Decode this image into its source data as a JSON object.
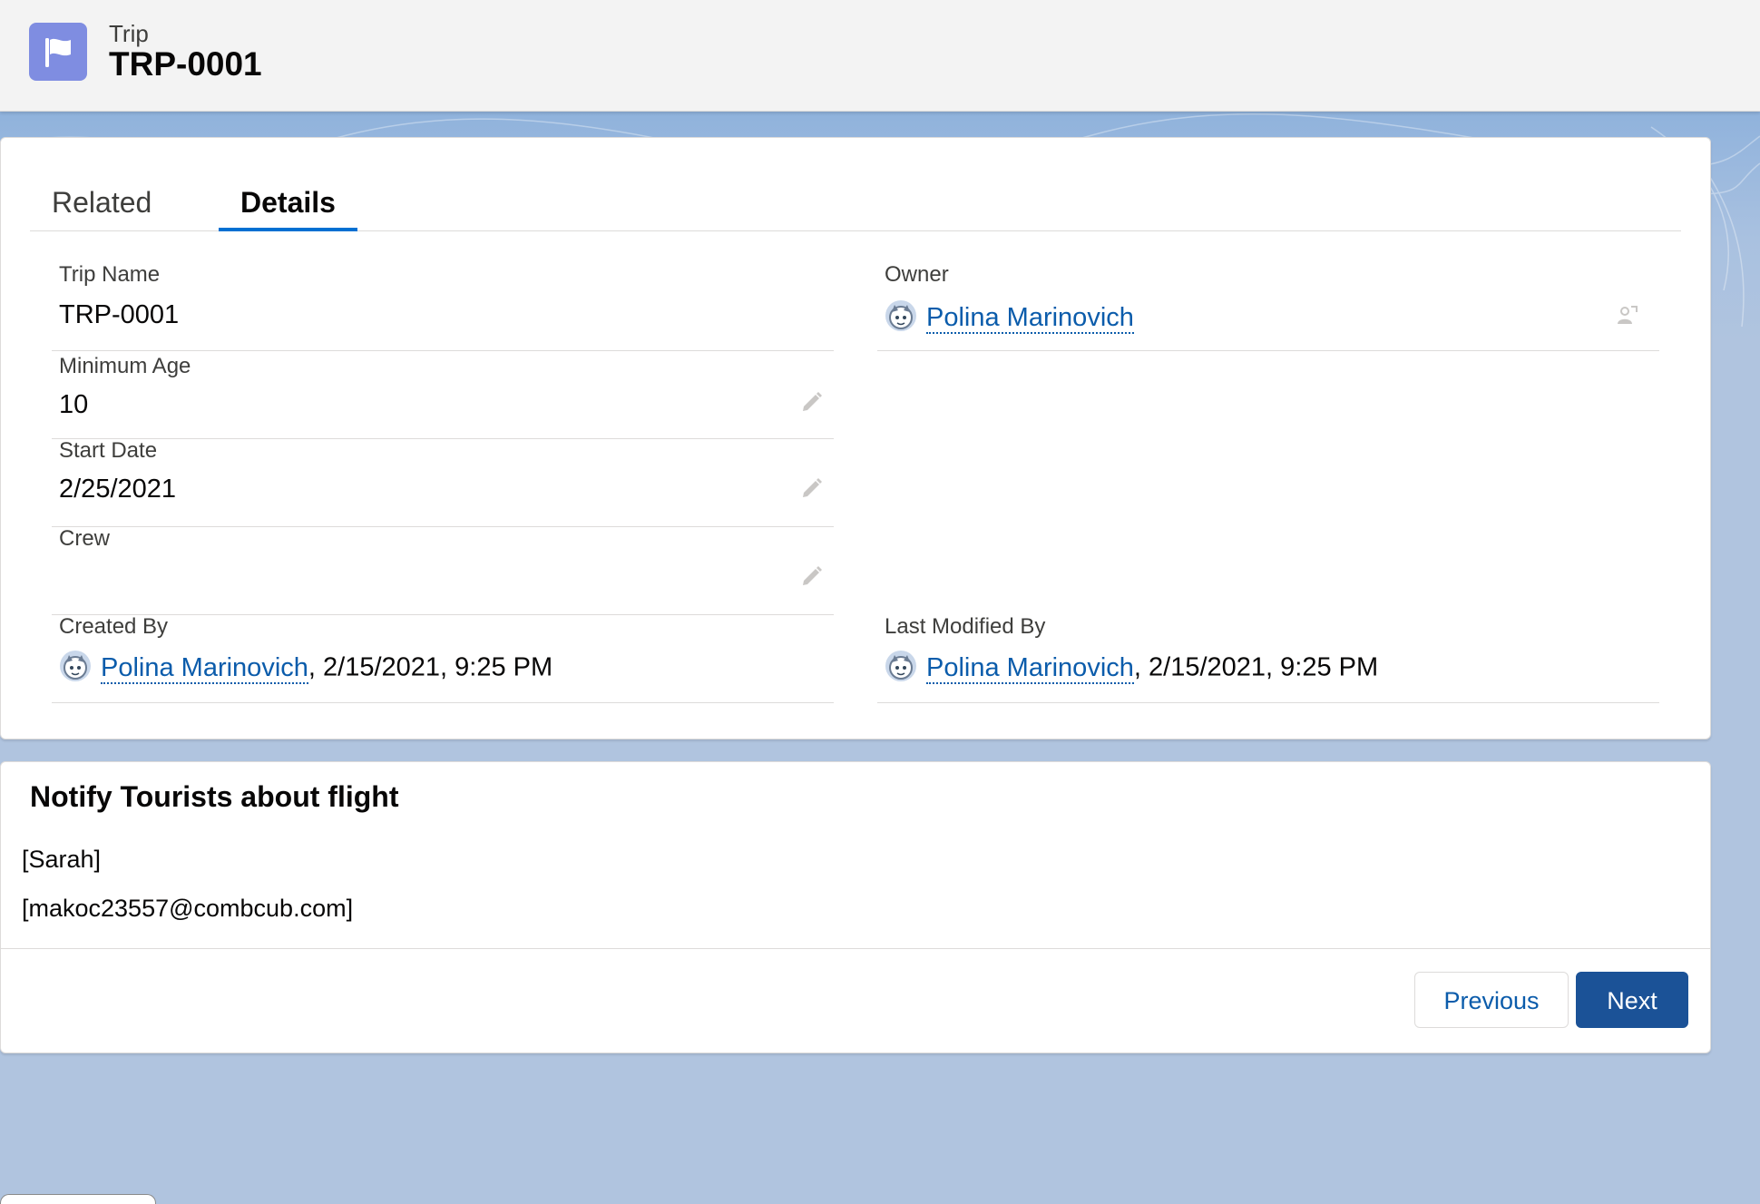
{
  "header": {
    "object_label": "Trip",
    "record_title": "TRP-0001",
    "icon": "flag-icon",
    "icon_color": "#7f8de1"
  },
  "tabs": [
    {
      "label": "Related",
      "active": false
    },
    {
      "label": "Details",
      "active": true
    }
  ],
  "details": {
    "trip_name": {
      "label": "Trip Name",
      "value": "TRP-0001"
    },
    "owner": {
      "label": "Owner",
      "value": "Polina Marinovich",
      "icon": "change-owner-icon"
    },
    "minimum_age": {
      "label": "Minimum Age",
      "value": "10"
    },
    "start_date": {
      "label": "Start Date",
      "value": "2/25/2021"
    },
    "crew": {
      "label": "Crew",
      "value": ""
    },
    "created_by": {
      "label": "Created By",
      "user": "Polina Marinovich",
      "timestamp": ", 2/15/2021, 9:25 PM"
    },
    "last_modified_by": {
      "label": "Last Modified By",
      "user": "Polina Marinovich",
      "timestamp": ", 2/15/2021, 9:25 PM"
    }
  },
  "notify": {
    "title": "Notify Tourists about flight",
    "lines": [
      "[Sarah]",
      "[makoc23557@combcub.com]"
    ],
    "previous_label": "Previous",
    "next_label": "Next"
  },
  "colors": {
    "accent": "#0070d2",
    "link": "#0b5cab",
    "brand_button": "#1b5297",
    "background": "#b0c4df"
  }
}
